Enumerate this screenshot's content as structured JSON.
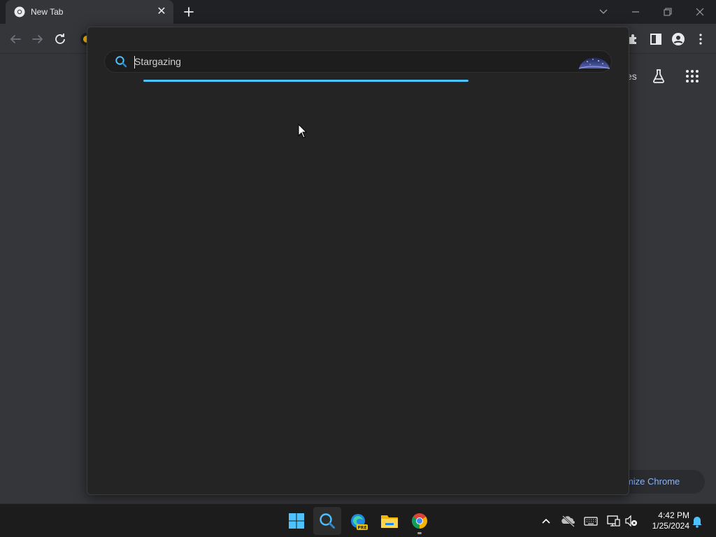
{
  "browser": {
    "tab_title": "New Tab",
    "tab_close_glyph": "✕"
  },
  "ntp": {
    "partial_link_text": "es",
    "customize_label": "Customize Chrome"
  },
  "search_popup": {
    "query_value": "Stargazing",
    "placeholder": "",
    "accent_color": "#4cc2ff"
  },
  "taskbar": {
    "time": "4:42 PM",
    "date": "1/25/2024",
    "apps": [
      "start-icon",
      "search-icon",
      "edge-preview-icon",
      "file-explorer-icon",
      "chrome-icon"
    ],
    "edge_badge": "PRE"
  },
  "icons": {
    "back": "arrow-left-icon",
    "forward": "arrow-right-icon",
    "reload": "reload-icon",
    "extensions": "puzzle-icon",
    "side_panel": "side-panel-icon",
    "profile": "profile-icon",
    "menu": "kebab-menu-icon",
    "labs": "flask-icon",
    "apps_grid": "apps-grid-icon"
  }
}
